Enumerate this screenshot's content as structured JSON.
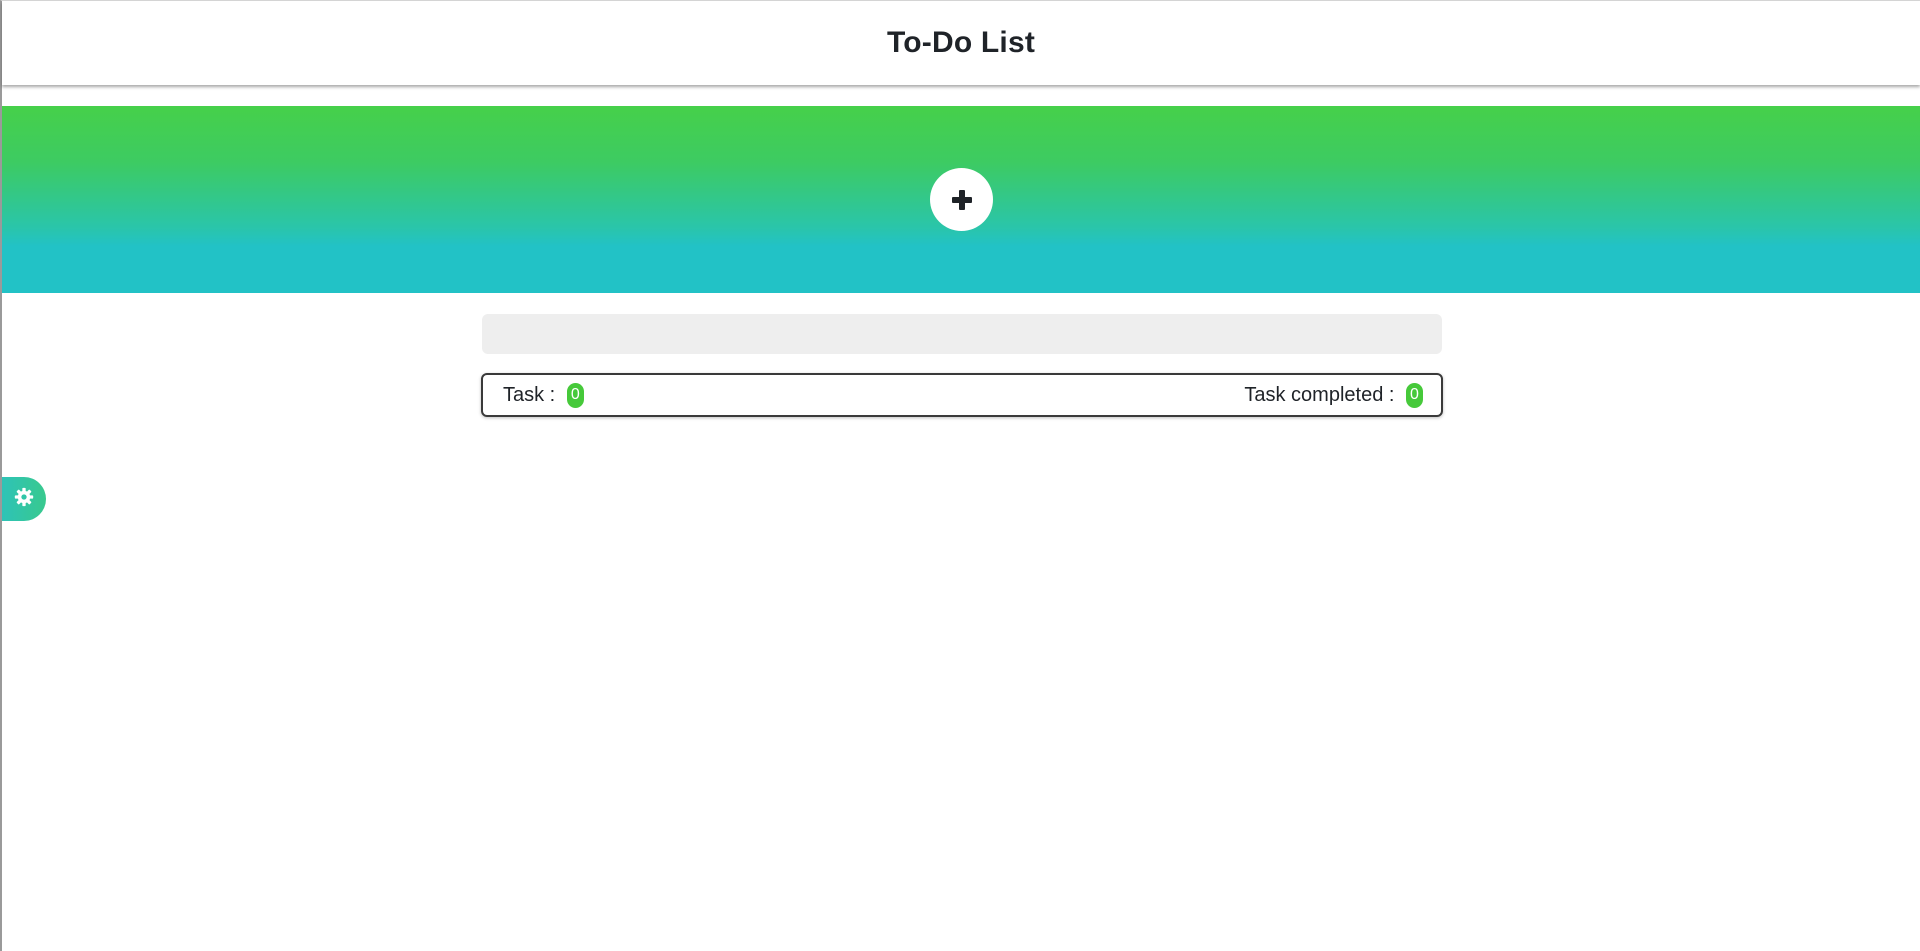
{
  "header": {
    "title": "To-Do List"
  },
  "hero": {
    "add_icon": "plus-icon"
  },
  "task_input": {
    "value": "",
    "placeholder": ""
  },
  "stats": {
    "task_label": "Task : ",
    "task_count": "0",
    "completed_label": "Task completed : ",
    "completed_count": "0"
  },
  "settings": {
    "icon": "gear-icon"
  },
  "colors": {
    "gradient_top": "#46d04a",
    "gradient_bottom": "#22c2c6",
    "badge": "#46c93a",
    "input_bg": "#eeeeee"
  }
}
